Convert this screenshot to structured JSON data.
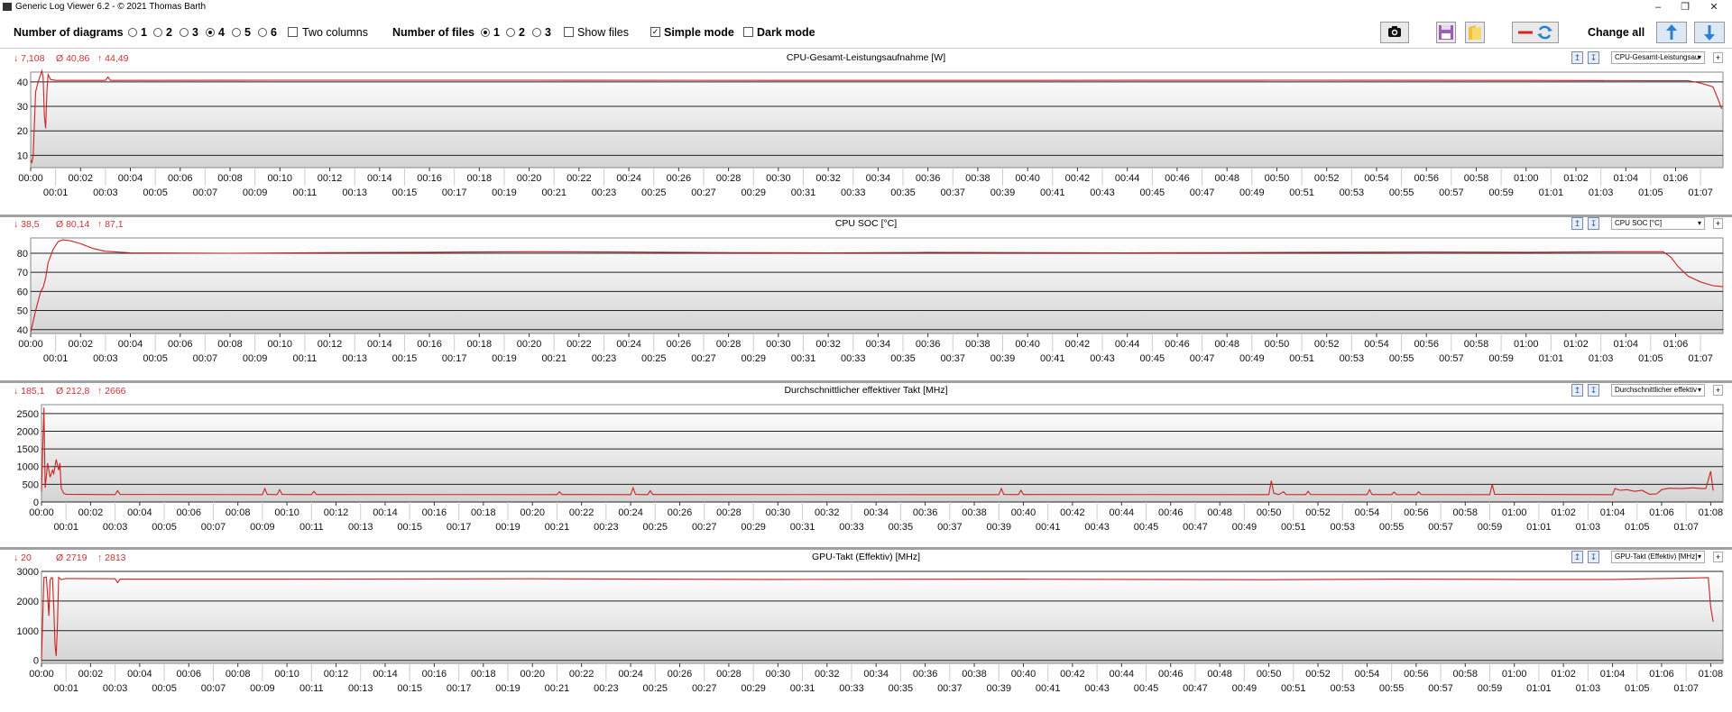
{
  "window": {
    "title": "Generic Log Viewer 6.2 - © 2021 Thomas Barth"
  },
  "toolbar": {
    "num_diagrams_label": "Number of diagrams",
    "diagram_options": [
      "1",
      "2",
      "3",
      "4",
      "5",
      "6"
    ],
    "diagram_selected": "4",
    "two_columns_label": "Two columns",
    "num_files_label": "Number of files",
    "file_options": [
      "1",
      "2",
      "3"
    ],
    "file_selected": "1",
    "show_files_label": "Show files",
    "simple_mode_label": "Simple mode",
    "simple_mode_checked": true,
    "dark_mode_label": "Dark mode",
    "change_all_label": "Change all"
  },
  "colors": {
    "line": "#cc2222",
    "stat": "#c83030",
    "plot_top": "#ffffff",
    "plot_bottom": "#d4d4d4"
  },
  "chart_data": [
    {
      "type": "line",
      "title": "CPU-Gesamt-Leistungsaufnahme [W]",
      "select_label": "CPU-Gesamt-Leistungsau",
      "stats": {
        "min": "↓ 7,108",
        "avg": "Ø 40,86",
        "max": "↑ 44,49"
      },
      "ylim": [
        5,
        44
      ],
      "yticks": [
        "10",
        "20",
        "30",
        "40"
      ],
      "ytick_values": [
        10,
        20,
        30,
        40
      ],
      "xlim": [
        0,
        67.9
      ],
      "xtick_row1": [
        "00:00",
        "00:02",
        "00:04",
        "00:06",
        "00:08",
        "00:10",
        "00:12",
        "00:14",
        "00:16",
        "00:18",
        "00:20",
        "00:22",
        "00:24",
        "00:26",
        "00:28",
        "00:30",
        "00:32",
        "00:34",
        "00:36",
        "00:38",
        "00:40",
        "00:42",
        "00:44",
        "00:46",
        "00:48",
        "00:50",
        "00:52",
        "00:54",
        "00:56",
        "00:58",
        "01:00",
        "01:02",
        "01:04",
        "01:06"
      ],
      "xtick_row2": [
        "00:01",
        "00:03",
        "00:05",
        "00:07",
        "00:09",
        "00:11",
        "00:13",
        "00:15",
        "00:17",
        "00:19",
        "00:21",
        "00:23",
        "00:25",
        "00:27",
        "00:29",
        "00:31",
        "00:33",
        "00:35",
        "00:37",
        "00:39",
        "00:41",
        "00:43",
        "00:45",
        "00:47",
        "00:49",
        "00:51",
        "00:53",
        "00:55",
        "00:57",
        "00:59",
        "01:01",
        "01:03",
        "01:05",
        "01:07"
      ],
      "series": [
        {
          "points": [
            [
              0,
              8
            ],
            [
              0.05,
              7.1
            ],
            [
              0.1,
              10
            ],
            [
              0.2,
              36
            ],
            [
              0.3,
              40
            ],
            [
              0.4,
              43
            ],
            [
              0.45,
              44.5
            ],
            [
              0.5,
              42
            ],
            [
              0.55,
              26
            ],
            [
              0.6,
              21
            ],
            [
              0.65,
              36
            ],
            [
              0.7,
              43
            ],
            [
              0.8,
              41
            ],
            [
              1,
              40.6
            ],
            [
              3,
              40.6
            ],
            [
              3.1,
              42
            ],
            [
              3.2,
              40.6
            ],
            [
              10,
              40.7
            ],
            [
              20,
              40.7
            ],
            [
              30,
              40.6
            ],
            [
              40,
              40.6
            ],
            [
              50,
              40.7
            ],
            [
              60,
              40.6
            ],
            [
              65,
              40.5
            ],
            [
              66.5,
              40.5
            ],
            [
              67,
              39.5
            ],
            [
              67.5,
              38
            ],
            [
              67.7,
              33
            ],
            [
              67.85,
              29
            ]
          ]
        }
      ]
    },
    {
      "type": "line",
      "title": "CPU SOC [°C]",
      "select_label": "CPU SOC [°C]",
      "stats": {
        "min": "↓ 38,5",
        "avg": "Ø 80,14",
        "max": "↑ 87,1"
      },
      "ylim": [
        38,
        88
      ],
      "yticks": [
        "40",
        "50",
        "60",
        "70",
        "80"
      ],
      "ytick_values": [
        40,
        50,
        60,
        70,
        80
      ],
      "xlim": [
        0,
        67.9
      ],
      "xtick_row1": [
        "00:00",
        "00:02",
        "00:04",
        "00:06",
        "00:08",
        "00:10",
        "00:12",
        "00:14",
        "00:16",
        "00:18",
        "00:20",
        "00:22",
        "00:24",
        "00:26",
        "00:28",
        "00:30",
        "00:32",
        "00:34",
        "00:36",
        "00:38",
        "00:40",
        "00:42",
        "00:44",
        "00:46",
        "00:48",
        "00:50",
        "00:52",
        "00:54",
        "00:56",
        "00:58",
        "01:00",
        "01:02",
        "01:04",
        "01:06"
      ],
      "xtick_row2": [
        "00:01",
        "00:03",
        "00:05",
        "00:07",
        "00:09",
        "00:11",
        "00:13",
        "00:15",
        "00:17",
        "00:19",
        "00:21",
        "00:23",
        "00:25",
        "00:27",
        "00:29",
        "00:31",
        "00:33",
        "00:35",
        "00:37",
        "00:39",
        "00:41",
        "00:43",
        "00:45",
        "00:47",
        "00:49",
        "00:51",
        "00:53",
        "00:55",
        "00:57",
        "00:59",
        "01:01",
        "01:03",
        "01:05",
        "01:07"
      ],
      "series": [
        {
          "points": [
            [
              0,
              38.5
            ],
            [
              0.2,
              50
            ],
            [
              0.4,
              60
            ],
            [
              0.5,
              62
            ],
            [
              0.6,
              67
            ],
            [
              0.7,
              75
            ],
            [
              0.9,
              82
            ],
            [
              1.1,
              86
            ],
            [
              1.3,
              87.1
            ],
            [
              1.6,
              86.5
            ],
            [
              2,
              85
            ],
            [
              2.5,
              82.5
            ],
            [
              3,
              81
            ],
            [
              4,
              80.2
            ],
            [
              8,
              80
            ],
            [
              12,
              80.3
            ],
            [
              16,
              80.5
            ],
            [
              20,
              80.8
            ],
            [
              24,
              80.6
            ],
            [
              28,
              80.3
            ],
            [
              32,
              80.2
            ],
            [
              36,
              80.4
            ],
            [
              40,
              80.3
            ],
            [
              44,
              80.2
            ],
            [
              48,
              80.3
            ],
            [
              52,
              80.5
            ],
            [
              56,
              80.6
            ],
            [
              60,
              80.5
            ],
            [
              64,
              80.8
            ],
            [
              65.5,
              80.8
            ],
            [
              65.8,
              78
            ],
            [
              66.1,
              73
            ],
            [
              66.5,
              68
            ],
            [
              67,
              65
            ],
            [
              67.5,
              63
            ],
            [
              67.9,
              62.5
            ]
          ]
        }
      ]
    },
    {
      "type": "line",
      "title": "Durchschnittlicher effektiver Takt [MHz]",
      "select_label": "Durchschnittlicher effektiv",
      "stats": {
        "min": "↓ 185,1",
        "avg": "Ø 212,8",
        "max": "↑ 2666"
      },
      "ylim": [
        0,
        2750
      ],
      "yticks": [
        "0",
        "500",
        "1000",
        "1500",
        "2000",
        "2500"
      ],
      "ytick_values": [
        0,
        500,
        1000,
        1500,
        2000,
        2500
      ],
      "xlim": [
        0,
        68.5
      ],
      "xtick_row1": [
        "00:00",
        "00:02",
        "00:04",
        "00:06",
        "00:08",
        "00:10",
        "00:12",
        "00:14",
        "00:16",
        "00:18",
        "00:20",
        "00:22",
        "00:24",
        "00:26",
        "00:28",
        "00:30",
        "00:32",
        "00:34",
        "00:36",
        "00:38",
        "00:40",
        "00:42",
        "00:44",
        "00:46",
        "00:48",
        "00:50",
        "00:52",
        "00:54",
        "00:56",
        "00:58",
        "01:00",
        "01:02",
        "01:04",
        "01:06",
        "01:08"
      ],
      "xtick_row2": [
        "00:01",
        "00:03",
        "00:05",
        "00:07",
        "00:09",
        "00:11",
        "00:13",
        "00:15",
        "00:17",
        "00:19",
        "00:21",
        "00:23",
        "00:25",
        "00:27",
        "00:29",
        "00:31",
        "00:33",
        "00:35",
        "00:37",
        "00:39",
        "00:41",
        "00:43",
        "00:45",
        "00:47",
        "00:49",
        "00:51",
        "00:53",
        "00:55",
        "00:57",
        "00:59",
        "01:01",
        "01:03",
        "01:05",
        "01:07"
      ],
      "series": [
        {
          "points": [
            [
              0,
              300
            ],
            [
              0.1,
              2666
            ],
            [
              0.15,
              400
            ],
            [
              0.25,
              1100
            ],
            [
              0.35,
              700
            ],
            [
              0.45,
              900
            ],
            [
              0.5,
              800
            ],
            [
              0.6,
              1200
            ],
            [
              0.7,
              900
            ],
            [
              0.75,
              1100
            ],
            [
              0.8,
              400
            ],
            [
              0.9,
              250
            ],
            [
              1,
              220
            ],
            [
              3,
              210
            ],
            [
              3.1,
              320
            ],
            [
              3.2,
              215
            ],
            [
              9,
              210
            ],
            [
              9.1,
              380
            ],
            [
              9.2,
              215
            ],
            [
              9.6,
              210
            ],
            [
              9.7,
              350
            ],
            [
              9.8,
              215
            ],
            [
              11,
              210
            ],
            [
              11.1,
              300
            ],
            [
              11.2,
              212
            ],
            [
              21,
              210
            ],
            [
              21.1,
              290
            ],
            [
              21.2,
              212
            ],
            [
              24,
              210
            ],
            [
              24.1,
              400
            ],
            [
              24.2,
              215
            ],
            [
              24.7,
              210
            ],
            [
              24.8,
              320
            ],
            [
              24.9,
              212
            ],
            [
              39,
              210
            ],
            [
              39.1,
              380
            ],
            [
              39.2,
              215
            ],
            [
              39.8,
              210
            ],
            [
              39.9,
              330
            ],
            [
              40,
              212
            ],
            [
              50,
              210
            ],
            [
              50.1,
              600
            ],
            [
              50.2,
              250
            ],
            [
              50.4,
              210
            ],
            [
              50.6,
              290
            ],
            [
              50.7,
              212
            ],
            [
              51.5,
              210
            ],
            [
              51.6,
              300
            ],
            [
              51.7,
              212
            ],
            [
              54,
              210
            ],
            [
              54.1,
              350
            ],
            [
              54.2,
              212
            ],
            [
              55,
              210
            ],
            [
              55.1,
              280
            ],
            [
              55.2,
              212
            ],
            [
              56,
              210
            ],
            [
              56.1,
              290
            ],
            [
              56.2,
              212
            ],
            [
              59,
              210
            ],
            [
              59.1,
              500
            ],
            [
              59.2,
              220
            ],
            [
              64,
              210
            ],
            [
              64.1,
              380
            ],
            [
              64.3,
              330
            ],
            [
              64.6,
              350
            ],
            [
              64.9,
              300
            ],
            [
              65.2,
              330
            ],
            [
              65.5,
              220
            ],
            [
              65.8,
              230
            ],
            [
              66,
              350
            ],
            [
              66.3,
              390
            ],
            [
              66.8,
              380
            ],
            [
              67.3,
              400
            ],
            [
              67.6,
              380
            ],
            [
              67.8,
              380
            ],
            [
              68,
              870
            ],
            [
              68.1,
              320
            ]
          ]
        }
      ]
    },
    {
      "type": "line",
      "title": "GPU-Takt (Effektiv) [MHz]",
      "select_label": "GPU-Takt (Effektiv) [MHz]",
      "stats": {
        "min": "↓ 20",
        "avg": "Ø 2719",
        "max": "↑ 2813"
      },
      "ylim": [
        -100,
        3000
      ],
      "yticks": [
        "0",
        "1000",
        "2000",
        "3000"
      ],
      "ytick_values": [
        0,
        1000,
        2000,
        3000
      ],
      "xlim": [
        0,
        68.5
      ],
      "xtick_row1": [
        "00:00",
        "00:02",
        "00:04",
        "00:06",
        "00:08",
        "00:10",
        "00:12",
        "00:14",
        "00:16",
        "00:18",
        "00:20",
        "00:22",
        "00:24",
        "00:26",
        "00:28",
        "00:30",
        "00:32",
        "00:34",
        "00:36",
        "00:38",
        "00:40",
        "00:42",
        "00:44",
        "00:46",
        "00:48",
        "00:50",
        "00:52",
        "00:54",
        "00:56",
        "00:58",
        "01:00",
        "01:02",
        "01:04",
        "01:06",
        "01:08"
      ],
      "xtick_row2": [
        "00:01",
        "00:03",
        "00:05",
        "00:07",
        "00:09",
        "00:11",
        "00:13",
        "00:15",
        "00:17",
        "00:19",
        "00:21",
        "00:23",
        "00:25",
        "00:27",
        "00:29",
        "00:31",
        "00:33",
        "00:35",
        "00:37",
        "00:39",
        "00:41",
        "00:43",
        "00:45",
        "00:47",
        "00:49",
        "00:51",
        "00:53",
        "00:55",
        "00:57",
        "00:59",
        "01:01",
        "01:03",
        "01:05",
        "01:07"
      ],
      "series": [
        {
          "points": [
            [
              0,
              20
            ],
            [
              0.1,
              2800
            ],
            [
              0.2,
              2813
            ],
            [
              0.3,
              1500
            ],
            [
              0.35,
              2700
            ],
            [
              0.4,
              2790
            ],
            [
              0.45,
              2780
            ],
            [
              0.5,
              1800
            ],
            [
              0.55,
              500
            ],
            [
              0.6,
              150
            ],
            [
              0.65,
              1200
            ],
            [
              0.7,
              2800
            ],
            [
              0.8,
              2720
            ],
            [
              1,
              2760
            ],
            [
              3,
              2750
            ],
            [
              3.1,
              2620
            ],
            [
              3.2,
              2740
            ],
            [
              10,
              2740
            ],
            [
              20,
              2750
            ],
            [
              30,
              2730
            ],
            [
              40,
              2740
            ],
            [
              50,
              2720
            ],
            [
              55,
              2740
            ],
            [
              60,
              2730
            ],
            [
              64,
              2730
            ],
            [
              67.5,
              2780
            ],
            [
              67.9,
              2790
            ],
            [
              68,
              1800
            ],
            [
              68.1,
              1300
            ]
          ]
        }
      ]
    }
  ]
}
